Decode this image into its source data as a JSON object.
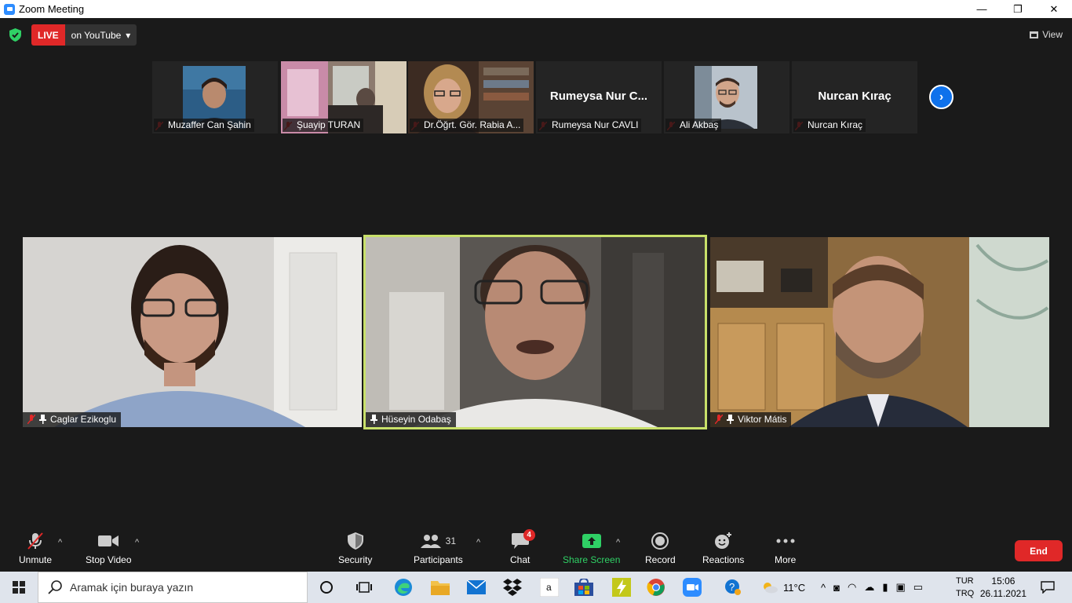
{
  "window": {
    "title": "Zoom Meeting",
    "minimize": "—",
    "maximize": "❐",
    "close": "✕"
  },
  "topbar": {
    "live_label": "LIVE",
    "live_destination": "on YouTube",
    "view_label": "View"
  },
  "strip": [
    {
      "name": "Muzaffer Can Şahin",
      "has_video": true
    },
    {
      "name": "Şuayip TURAN",
      "has_video": true
    },
    {
      "name": "Dr.Öğrt. Gör. Rabia A...",
      "has_video": true
    },
    {
      "name": "Rumeysa Nur CAVLI",
      "display_name": "Rumeysa Nur C...",
      "has_video": false
    },
    {
      "name": "Ali Akbaş",
      "has_video": true
    },
    {
      "name": "Nurcan Kıraç",
      "display_name": "Nurcan Kıraç",
      "has_video": false
    }
  ],
  "main": [
    {
      "name": "Caglar Ezikoglu",
      "muted": true,
      "pinned": true
    },
    {
      "name": "Hüseyin Odabaş",
      "muted": false,
      "pinned": true,
      "active_speaker": true
    },
    {
      "name": "Viktor Mátis",
      "muted": true,
      "pinned": true
    }
  ],
  "toolbar": {
    "unmute": "Unmute",
    "stop_video": "Stop Video",
    "security": "Security",
    "participants": "Participants",
    "participants_count": "31",
    "chat": "Chat",
    "chat_badge": "4",
    "share_screen": "Share Screen",
    "record": "Record",
    "reactions": "Reactions",
    "more": "More",
    "end": "End"
  },
  "taskbar": {
    "search_placeholder": "Aramak için buraya yazın",
    "weather": "11°C",
    "lang_top": "TUR",
    "lang_bottom": "TRQ",
    "time": "15:06",
    "date": "26.11.2021"
  },
  "colors": {
    "live_red": "#e02828",
    "speaker_outline": "#c8e06a",
    "share_green": "#2fd065",
    "zoom_blue": "#0e71eb"
  }
}
